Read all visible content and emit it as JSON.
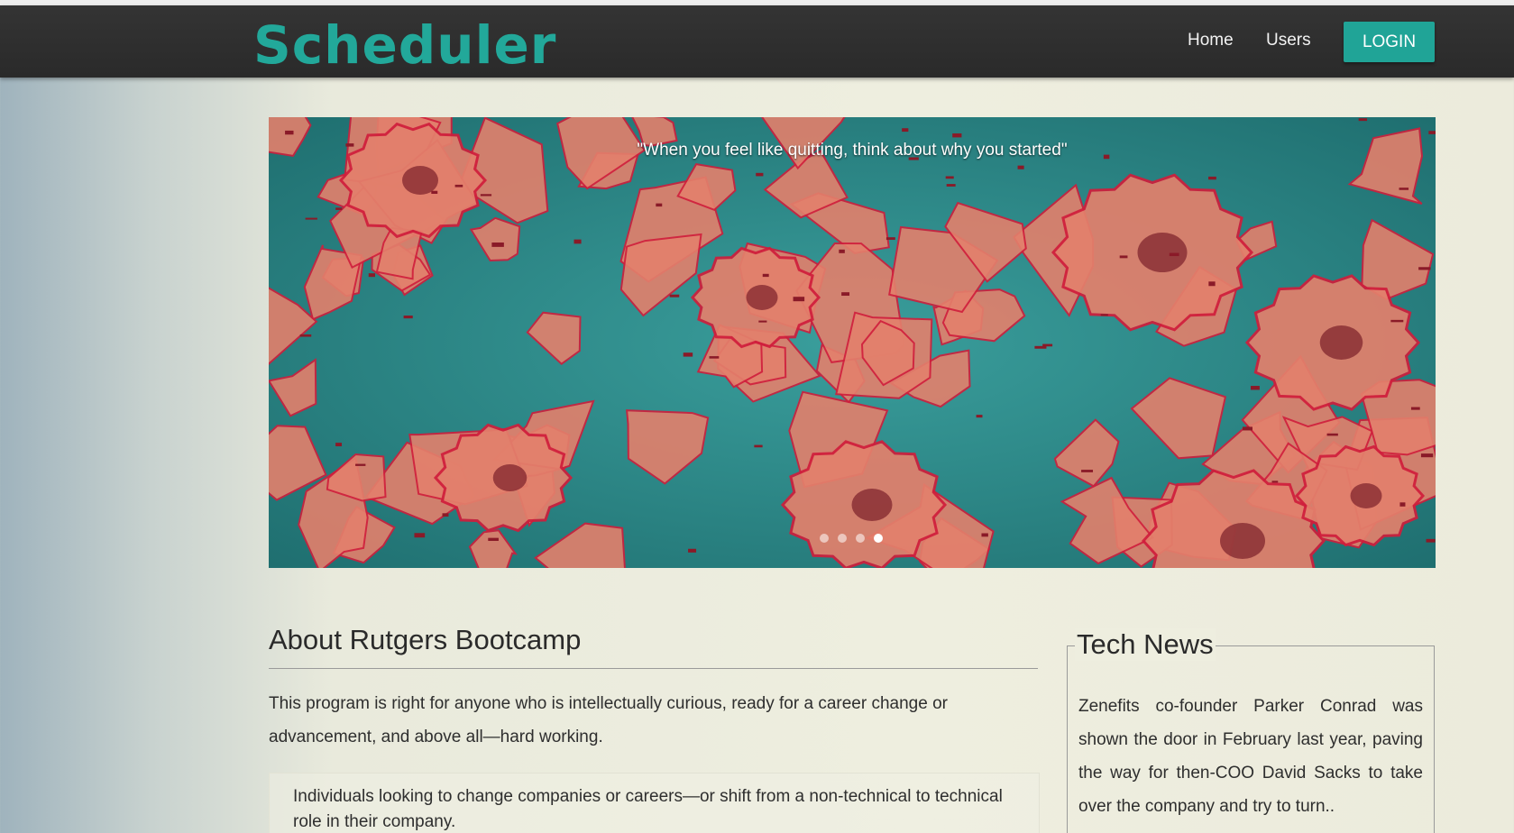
{
  "navbar": {
    "brand": "Scheduler",
    "links": [
      "Home",
      "Users"
    ],
    "login_label": "LOGIN"
  },
  "carousel": {
    "quote": "\"When you feel like quitting, think about why you started\"",
    "slide_count": 4,
    "active_index": 3
  },
  "about": {
    "title": "About Rutgers Bootcamp",
    "text": "This program is right for anyone who is intellectually curious, ready for a career change or advancement, and above all—hard working.",
    "quote": "Individuals looking to change companies or careers—or shift from a non-technical to technical role in their company."
  },
  "news": {
    "title": "Tech News",
    "text": "Zenefits co-founder Parker Conrad was shown the door in February last year, paving the way for then-COO David Sacks to take over the company and try to turn.."
  },
  "colors": {
    "accent": "#22a89a",
    "navbar": "#2d2d2d",
    "carousel_bg": "#2f8e8c",
    "shaving": "#e3806c",
    "shaving_edge": "#d01e3c"
  }
}
